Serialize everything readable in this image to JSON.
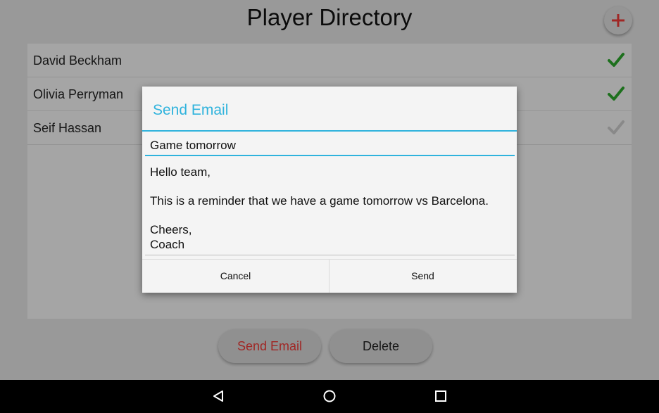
{
  "app": {
    "title": "Player Directory",
    "add_icon": "plus-icon",
    "accent_red": "#e53935",
    "check_green": "#2aa12a"
  },
  "players": [
    {
      "name": "David Beckham",
      "checked": true
    },
    {
      "name": "Olivia Perryman",
      "checked": true
    },
    {
      "name": "Seif Hassan",
      "checked": false
    }
  ],
  "actions": {
    "send_email": "Send Email",
    "delete": "Delete"
  },
  "dialog": {
    "title": "Send Email",
    "subject": "Game tomorrow",
    "body": "Hello team,\n\nThis is a reminder that we have a game tomorrow vs Barcelona.\n\nCheers,\nCoach",
    "cancel": "Cancel",
    "send": "Send",
    "accent": "#2fb3dd"
  },
  "navbar": {
    "back_icon": "back-triangle-icon",
    "home_icon": "home-circle-icon",
    "recents_icon": "recents-square-icon"
  }
}
